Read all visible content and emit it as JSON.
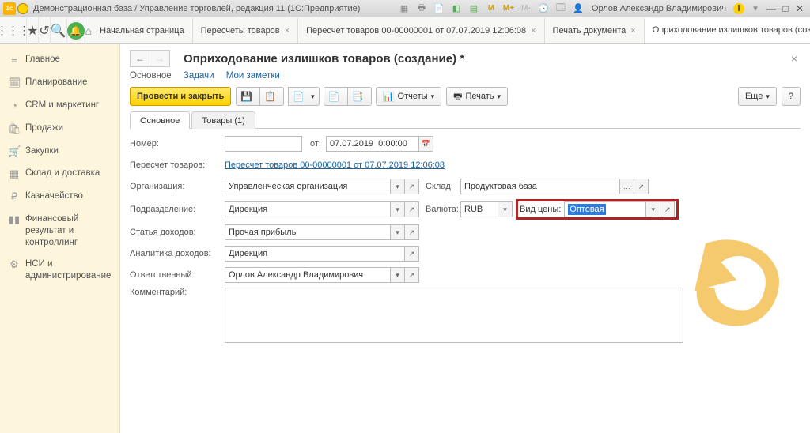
{
  "titlebar": {
    "title": "Демонстрационная база / Управление торговлей, редакция 11 (1С:Предприятие)",
    "user": "Орлов Александр Владимирович"
  },
  "toolbar": {
    "home_label": "Начальная страница",
    "tabs": [
      {
        "label": "Пересчеты товаров"
      },
      {
        "label": "Пересчет товаров 00-00000001 от 07.07.2019 12:06:08"
      },
      {
        "label": "Печать документа"
      },
      {
        "label": "Оприходование излишков товаров (создание) *",
        "active": true
      }
    ]
  },
  "sidebar": {
    "items": [
      {
        "icon": "≡",
        "label": "Главное"
      },
      {
        "icon": "📅",
        "label": "Планирование"
      },
      {
        "icon": "◔",
        "label": "CRM и маркетинг"
      },
      {
        "icon": "🛍",
        "label": "Продажи"
      },
      {
        "icon": "🛒",
        "label": "Закупки"
      },
      {
        "icon": "▦",
        "label": "Склад и доставка"
      },
      {
        "icon": "₽",
        "label": "Казначейство"
      },
      {
        "icon": "▮▮",
        "label": "Финансовый результат и контроллинг"
      },
      {
        "icon": "⚙",
        "label": "НСИ и администрирование"
      }
    ]
  },
  "doc": {
    "title": "Оприходование излишков товаров (создание) *",
    "subtabs": {
      "main": "Основное",
      "tasks": "Задачи",
      "notes": "Мои заметки"
    },
    "cmd": {
      "post_close": "Провести и закрыть",
      "reports": "Отчеты",
      "print": "Печать",
      "more": "Еще",
      "help": "?"
    },
    "formtabs": {
      "main": "Основное",
      "goods": "Товары (1)"
    },
    "fields": {
      "number_lbl": "Номер:",
      "number_val": "",
      "from_lbl": "от:",
      "date_val": "07.07.2019  0:00:00",
      "recount_lbl": "Пересчет товаров:",
      "recount_link": "Пересчет товаров 00-00000001 от 07.07.2019 12:06:08",
      "org_lbl": "Организация:",
      "org_val": "Управленческая организация",
      "warehouse_lbl": "Склад:",
      "warehouse_val": "Продуктовая база",
      "dept_lbl": "Подразделение:",
      "dept_val": "Дирекция",
      "currency_lbl": "Валюта:",
      "currency_val": "RUB",
      "pricetype_lbl": "Вид цены:",
      "pricetype_val": "Оптовая",
      "income_lbl": "Статья доходов:",
      "income_val": "Прочая прибыль",
      "analytics_lbl": "Аналитика доходов:",
      "analytics_val": "Дирекция",
      "resp_lbl": "Ответственный:",
      "resp_val": "Орлов Александр Владимирович",
      "comment_lbl": "Комментарий:"
    }
  }
}
